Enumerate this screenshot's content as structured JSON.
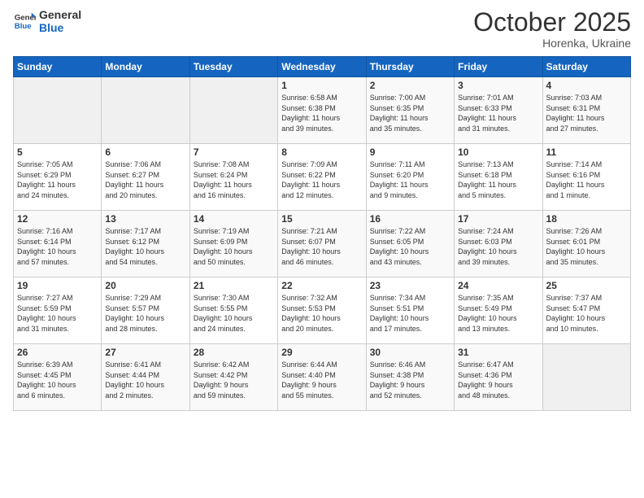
{
  "header": {
    "logo_general": "General",
    "logo_blue": "Blue",
    "month_title": "October 2025",
    "location": "Horenka, Ukraine"
  },
  "weekdays": [
    "Sunday",
    "Monday",
    "Tuesday",
    "Wednesday",
    "Thursday",
    "Friday",
    "Saturday"
  ],
  "weeks": [
    [
      {
        "day": "",
        "text": ""
      },
      {
        "day": "",
        "text": ""
      },
      {
        "day": "",
        "text": ""
      },
      {
        "day": "1",
        "text": "Sunrise: 6:58 AM\nSunset: 6:38 PM\nDaylight: 11 hours\nand 39 minutes."
      },
      {
        "day": "2",
        "text": "Sunrise: 7:00 AM\nSunset: 6:35 PM\nDaylight: 11 hours\nand 35 minutes."
      },
      {
        "day": "3",
        "text": "Sunrise: 7:01 AM\nSunset: 6:33 PM\nDaylight: 11 hours\nand 31 minutes."
      },
      {
        "day": "4",
        "text": "Sunrise: 7:03 AM\nSunset: 6:31 PM\nDaylight: 11 hours\nand 27 minutes."
      }
    ],
    [
      {
        "day": "5",
        "text": "Sunrise: 7:05 AM\nSunset: 6:29 PM\nDaylight: 11 hours\nand 24 minutes."
      },
      {
        "day": "6",
        "text": "Sunrise: 7:06 AM\nSunset: 6:27 PM\nDaylight: 11 hours\nand 20 minutes."
      },
      {
        "day": "7",
        "text": "Sunrise: 7:08 AM\nSunset: 6:24 PM\nDaylight: 11 hours\nand 16 minutes."
      },
      {
        "day": "8",
        "text": "Sunrise: 7:09 AM\nSunset: 6:22 PM\nDaylight: 11 hours\nand 12 minutes."
      },
      {
        "day": "9",
        "text": "Sunrise: 7:11 AM\nSunset: 6:20 PM\nDaylight: 11 hours\nand 9 minutes."
      },
      {
        "day": "10",
        "text": "Sunrise: 7:13 AM\nSunset: 6:18 PM\nDaylight: 11 hours\nand 5 minutes."
      },
      {
        "day": "11",
        "text": "Sunrise: 7:14 AM\nSunset: 6:16 PM\nDaylight: 11 hours\nand 1 minute."
      }
    ],
    [
      {
        "day": "12",
        "text": "Sunrise: 7:16 AM\nSunset: 6:14 PM\nDaylight: 10 hours\nand 57 minutes."
      },
      {
        "day": "13",
        "text": "Sunrise: 7:17 AM\nSunset: 6:12 PM\nDaylight: 10 hours\nand 54 minutes."
      },
      {
        "day": "14",
        "text": "Sunrise: 7:19 AM\nSunset: 6:09 PM\nDaylight: 10 hours\nand 50 minutes."
      },
      {
        "day": "15",
        "text": "Sunrise: 7:21 AM\nSunset: 6:07 PM\nDaylight: 10 hours\nand 46 minutes."
      },
      {
        "day": "16",
        "text": "Sunrise: 7:22 AM\nSunset: 6:05 PM\nDaylight: 10 hours\nand 43 minutes."
      },
      {
        "day": "17",
        "text": "Sunrise: 7:24 AM\nSunset: 6:03 PM\nDaylight: 10 hours\nand 39 minutes."
      },
      {
        "day": "18",
        "text": "Sunrise: 7:26 AM\nSunset: 6:01 PM\nDaylight: 10 hours\nand 35 minutes."
      }
    ],
    [
      {
        "day": "19",
        "text": "Sunrise: 7:27 AM\nSunset: 5:59 PM\nDaylight: 10 hours\nand 31 minutes."
      },
      {
        "day": "20",
        "text": "Sunrise: 7:29 AM\nSunset: 5:57 PM\nDaylight: 10 hours\nand 28 minutes."
      },
      {
        "day": "21",
        "text": "Sunrise: 7:30 AM\nSunset: 5:55 PM\nDaylight: 10 hours\nand 24 minutes."
      },
      {
        "day": "22",
        "text": "Sunrise: 7:32 AM\nSunset: 5:53 PM\nDaylight: 10 hours\nand 20 minutes."
      },
      {
        "day": "23",
        "text": "Sunrise: 7:34 AM\nSunset: 5:51 PM\nDaylight: 10 hours\nand 17 minutes."
      },
      {
        "day": "24",
        "text": "Sunrise: 7:35 AM\nSunset: 5:49 PM\nDaylight: 10 hours\nand 13 minutes."
      },
      {
        "day": "25",
        "text": "Sunrise: 7:37 AM\nSunset: 5:47 PM\nDaylight: 10 hours\nand 10 minutes."
      }
    ],
    [
      {
        "day": "26",
        "text": "Sunrise: 6:39 AM\nSunset: 4:45 PM\nDaylight: 10 hours\nand 6 minutes."
      },
      {
        "day": "27",
        "text": "Sunrise: 6:41 AM\nSunset: 4:44 PM\nDaylight: 10 hours\nand 2 minutes."
      },
      {
        "day": "28",
        "text": "Sunrise: 6:42 AM\nSunset: 4:42 PM\nDaylight: 9 hours\nand 59 minutes."
      },
      {
        "day": "29",
        "text": "Sunrise: 6:44 AM\nSunset: 4:40 PM\nDaylight: 9 hours\nand 55 minutes."
      },
      {
        "day": "30",
        "text": "Sunrise: 6:46 AM\nSunset: 4:38 PM\nDaylight: 9 hours\nand 52 minutes."
      },
      {
        "day": "31",
        "text": "Sunrise: 6:47 AM\nSunset: 4:36 PM\nDaylight: 9 hours\nand 48 minutes."
      },
      {
        "day": "",
        "text": ""
      }
    ]
  ]
}
